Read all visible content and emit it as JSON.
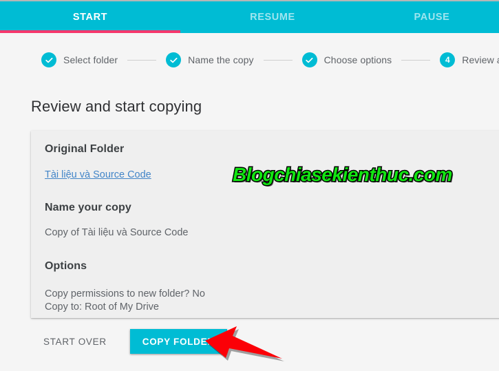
{
  "colors": {
    "accent_teal": "#00bcd4",
    "active_tab_underline": "#f5376c",
    "link_blue": "#4285c8",
    "card_bg": "#efefef",
    "page_bg": "#f5f5f5",
    "arrow_red": "#fb0007",
    "watermark_green": "#12e512"
  },
  "tabs": [
    {
      "label": "START",
      "active": true
    },
    {
      "label": "RESUME",
      "active": false
    },
    {
      "label": "PAUSE",
      "active": false
    }
  ],
  "stepper": {
    "steps": [
      {
        "label": "Select folder",
        "state": "complete",
        "marker": "check"
      },
      {
        "label": "Name the copy",
        "state": "complete",
        "marker": "check"
      },
      {
        "label": "Choose options",
        "state": "complete",
        "marker": "check"
      },
      {
        "label": "Review and confirm",
        "state": "current",
        "marker": "4"
      }
    ]
  },
  "page": {
    "title": "Review and start copying"
  },
  "card": {
    "original_folder_heading": "Original Folder",
    "original_folder_link": "Tài liệu và Source Code",
    "name_your_copy_heading": "Name your copy",
    "name_your_copy_value": "Copy of Tài liệu và Source Code",
    "options_heading": "Options",
    "options_line_1": "Copy permissions to new folder? No",
    "options_line_2": "Copy to: Root of My Drive"
  },
  "actions": {
    "start_over_label": "START OVER",
    "copy_folder_label": "COPY FOLDER"
  },
  "annotation": {
    "arrow_direction": "left",
    "arrow_target": "COPY FOLDER"
  },
  "watermark": {
    "text": "Blogchiasekienthuc.com"
  }
}
